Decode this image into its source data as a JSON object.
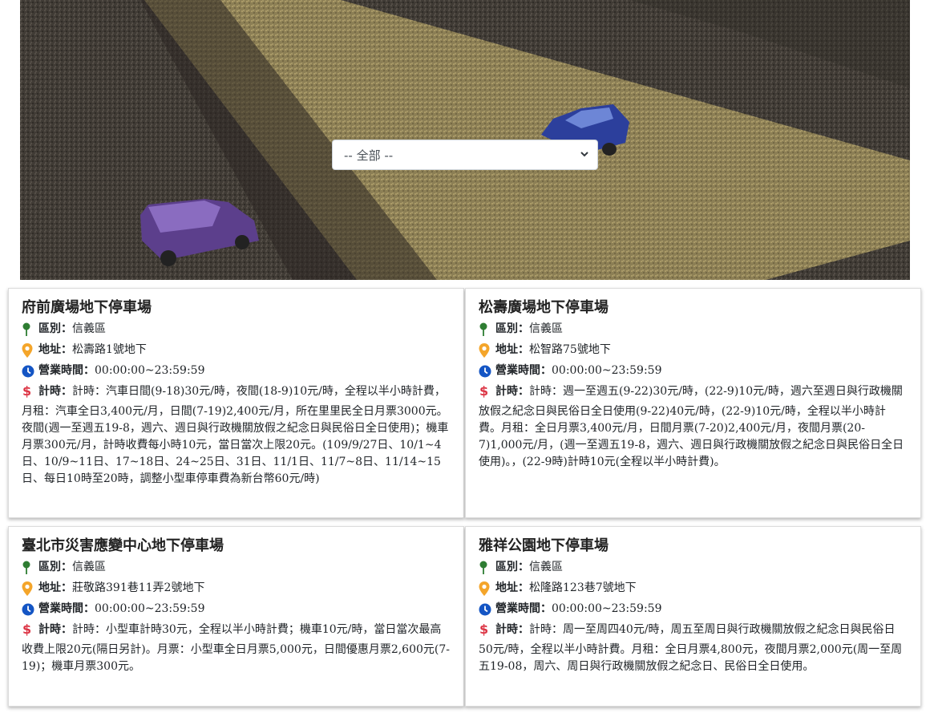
{
  "filter": {
    "selected": "-- 全部 --"
  },
  "labels": {
    "district": "區別：",
    "address": "地址：",
    "hours": "營業時間：",
    "fee": "計時："
  },
  "colors": {
    "pin_green": "#2e7d32",
    "marker_orange": "#f4a52a",
    "clock_blue": "#1455c4",
    "dollar_red": "#dc3545"
  },
  "parkings": [
    {
      "name": "府前廣場地下停車場",
      "district": "信義區",
      "address": "松壽路1號地下",
      "hours": "00:00:00~23:59:59",
      "fee": "計時：汽車日間(9-18)30元/時，夜間(18-9)10元/時，全程以半小時計費，月租：汽車全日3,400元/月，日間(7-19)2,400元/月，所在里里民全日月票3000元。夜間(週一至週五19-8，週六、週日與行政機關放假之紀念日與民俗日全日使用)；機車月票300元/月，計時收費每小時10元，當日當次上限20元。(109/9/27日、10/1~4日、10/9~11日、17~18日、24~25日、31日、11/1日、11/7~8日、11/14~15日、每日10時至20時，調整小型車停車費為新台幣60元/時)"
    },
    {
      "name": "松壽廣場地下停車場",
      "district": "信義區",
      "address": "松智路75號地下",
      "hours": "00:00:00~23:59:59",
      "fee": "計時：週一至週五(9-22)30元/時，(22-9)10元/時，週六至週日與行政機關放假之紀念日與民俗日全日使用(9-22)40元/時，(22-9)10元/時，全程以半小時計費。月租：全日月票3,400元/月，日間月票(7-20)2,400元/月，夜間月票(20-7)1,000元/月，(週一至週五19-8，週六、週日與行政機關放假之紀念日與民俗日全日使用)。，(22-9時)計時10元(全程以半小時計費)。"
    },
    {
      "name": "臺北市災害應變中心地下停車場",
      "district": "信義區",
      "address": "莊敬路391巷11弄2號地下",
      "hours": "00:00:00~23:59:59",
      "fee": "計時：小型車計時30元，全程以半小時計費；機車10元/時，當日當次最高收費上限20元(隔日另計)。月票：小型車全日月票5,000元，日間優惠月票2,600元(7-19)；機車月票300元。"
    },
    {
      "name": "雅祥公園地下停車場",
      "district": "信義區",
      "address": "松隆路123巷7號地下",
      "hours": "00:00:00~23:59:59",
      "fee": "計時：周一至周四40元/時，周五至周日與行政機關放假之紀念日與民俗日50元/時，全程以半小時計費。月租：全日月票4,800元，夜間月票2,000元(周一至周五19-08，周六、周日與行政機關放假之紀念日、民俗日全日使用。"
    }
  ]
}
